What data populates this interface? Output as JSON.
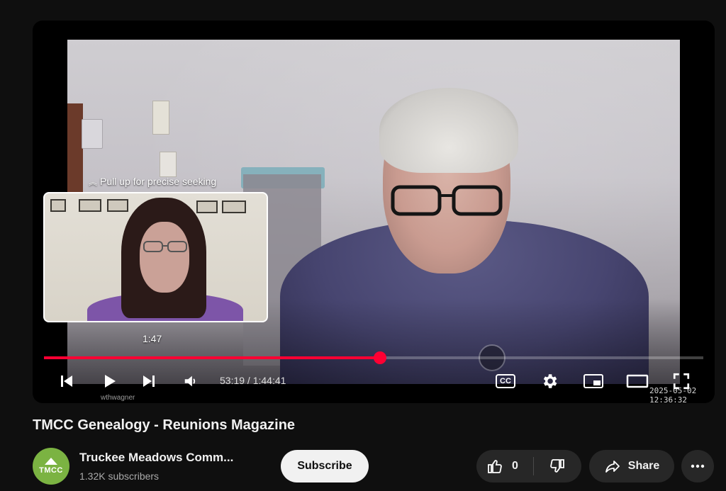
{
  "player": {
    "seek_hint": "Pull up for precise seeking",
    "preview_time": "1:47",
    "current_time": "53:19",
    "duration": "1:44:41",
    "time_display": "53:19 / 1:44:41",
    "progress_fraction": 0.51,
    "overlay_timestamp": "2025-05-02  12:36:32",
    "overlay_name": "wthwagner",
    "controls": {
      "prev": "previous-icon",
      "play": "play-icon",
      "next": "next-icon",
      "volume": "volume-icon",
      "captions_label": "CC",
      "settings": "gear-icon",
      "miniplayer": "miniplayer-icon",
      "theater": "theater-icon",
      "fullscreen": "fullscreen-icon"
    },
    "accent_color": "#ff0033"
  },
  "video": {
    "title": "TMCC Genealogy - Reunions Magazine"
  },
  "channel": {
    "avatar_text": "TMCC",
    "name": "Truckee Meadows Comm...",
    "subscribers": "1.32K subscribers",
    "avatar_color": "#7bb342"
  },
  "actions": {
    "subscribe_label": "Subscribe",
    "like_count": "0",
    "share_label": "Share"
  }
}
